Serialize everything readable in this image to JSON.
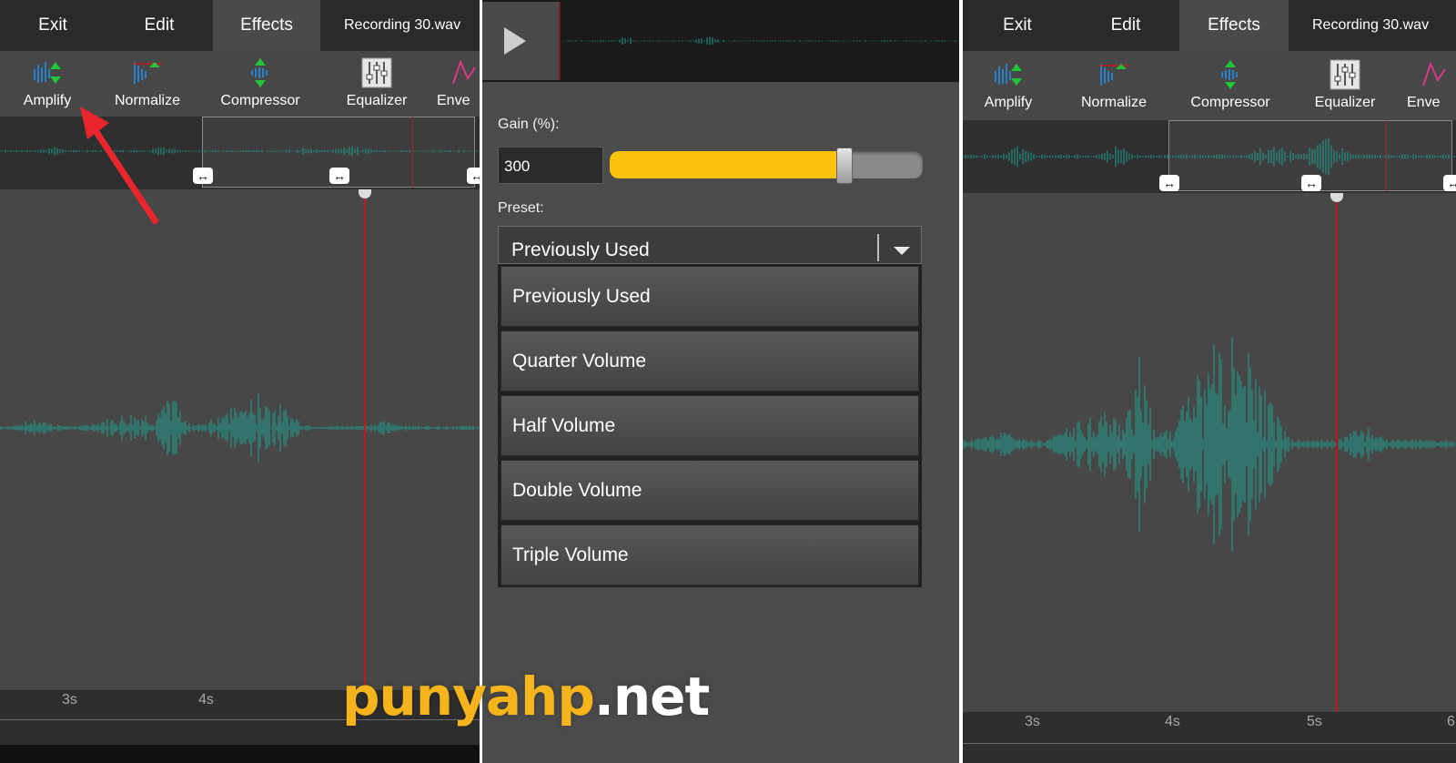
{
  "menu": {
    "exit": "Exit",
    "edit": "Edit",
    "effects": "Effects",
    "file": "Recording 30.wav"
  },
  "tools": [
    {
      "label": "Amplify",
      "icon": "amplify-icon"
    },
    {
      "label": "Normalize",
      "icon": "normalize-icon"
    },
    {
      "label": "Compressor",
      "icon": "compressor-icon"
    },
    {
      "label": "Equalizer",
      "icon": "equalizer-icon"
    },
    {
      "label": "Enve",
      "icon": "envelope-icon"
    }
  ],
  "timeline": {
    "ticks": [
      "3s",
      "4s",
      "5s",
      "6"
    ]
  },
  "dialog": {
    "gain_label": "Gain (%):",
    "gain_value": "300",
    "gain_slider_fraction": 0.75,
    "preset_label": "Preset:",
    "preset_selected": "Previously Used",
    "preset_options": [
      "Previously Used",
      "Quarter Volume",
      "Half Volume",
      "Double Volume",
      "Triple Volume"
    ]
  },
  "watermark": {
    "part1": "punyahp",
    "part2": ".net"
  },
  "colors": {
    "waveform": "#1ca192",
    "playhead": "#c0181d",
    "slider": "#f8c20f",
    "arrow": "#e8262b"
  }
}
